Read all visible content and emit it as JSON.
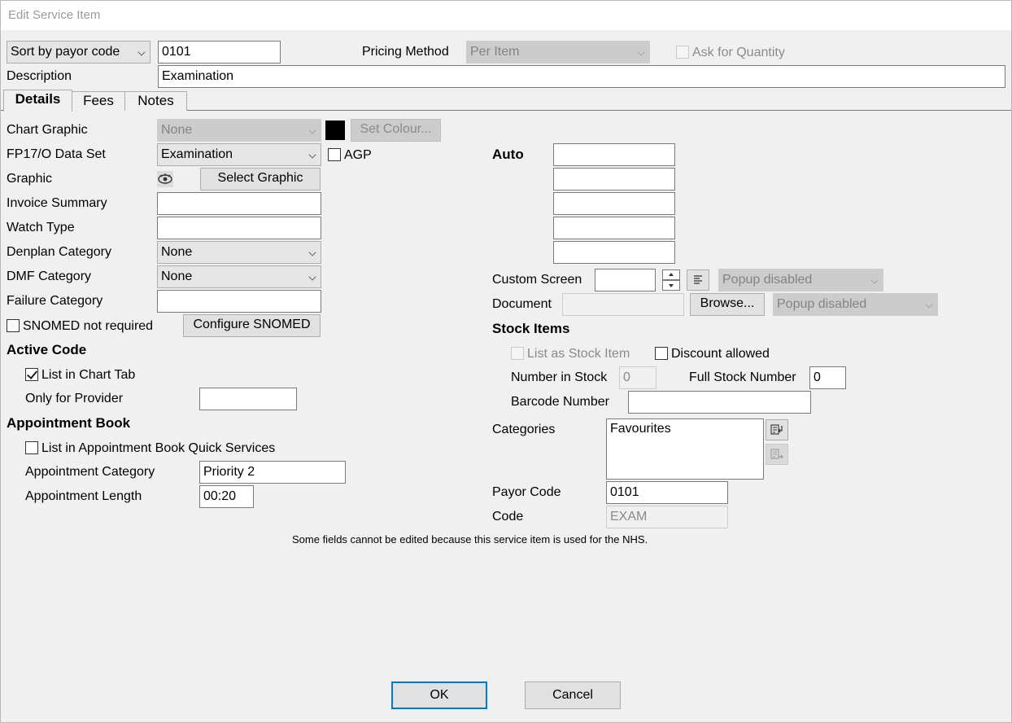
{
  "window": {
    "title": "Edit Service Item"
  },
  "header": {
    "sort_select": "Sort by payor code",
    "code_value": "0101",
    "pricing_method_label": "Pricing Method",
    "pricing_method_value": "Per Item",
    "ask_quantity_label": "Ask for Quantity",
    "description_label": "Description",
    "description_value": "Examination"
  },
  "tabs": [
    {
      "label": "Details"
    },
    {
      "label": "Fees"
    },
    {
      "label": "Notes"
    }
  ],
  "left": {
    "chart_graphic_label": "Chart Graphic",
    "chart_graphic_value": "None",
    "set_colour_label": "Set Colour...",
    "colour_swatch": "#000000",
    "fp17_label": "FP17/O Data Set",
    "fp17_value": "Examination",
    "agp_label": "AGP",
    "graphic_label": "Graphic",
    "select_graphic_label": "Select Graphic",
    "invoice_summary_label": "Invoice Summary",
    "invoice_summary_value": "",
    "watch_type_label": "Watch Type",
    "watch_type_value": "",
    "denplan_label": "Denplan Category",
    "denplan_value": "None",
    "dmf_label": "DMF Category",
    "dmf_value": "None",
    "failure_label": "Failure Category",
    "failure_value": "",
    "snomed_label": "SNOMED not required",
    "configure_snomed_label": "Configure SNOMED",
    "active_code_heading": "Active Code",
    "list_chart_tab_label": "List in Chart Tab",
    "only_provider_label": "Only for Provider",
    "only_provider_value": "",
    "appointment_book_heading": "Appointment Book",
    "list_quick_label": "List in Appointment Book Quick Services",
    "appt_category_label": "Appointment Category",
    "appt_category_value": "Priority 2",
    "appt_length_label": "Appointment Length",
    "appt_length_value": "00:20"
  },
  "right": {
    "auto_label": "Auto",
    "auto_values": [
      "",
      "",
      "",
      "",
      ""
    ],
    "custom_screen_label": "Custom Screen",
    "custom_screen_value": "",
    "custom_popup_value": "Popup disabled",
    "document_label": "Document",
    "document_value": "",
    "browse_label": "Browse...",
    "document_popup_value": "Popup disabled",
    "stock_items_heading": "Stock Items",
    "list_stock_label": "List as Stock Item",
    "discount_label": "Discount allowed",
    "number_in_stock_label": "Number in Stock",
    "number_in_stock_value": "0",
    "full_stock_label": "Full Stock Number",
    "full_stock_value": "0",
    "barcode_label": "Barcode Number",
    "barcode_value": "",
    "categories_label": "Categories",
    "categories": [
      "Favourites"
    ],
    "payor_code_label": "Payor Code",
    "payor_code_value": "0101",
    "code_label": "Code",
    "code_value": "EXAM"
  },
  "footer": {
    "note": "Some fields cannot be edited because this service item is used for the NHS.",
    "ok_label": "OK",
    "cancel_label": "Cancel"
  }
}
